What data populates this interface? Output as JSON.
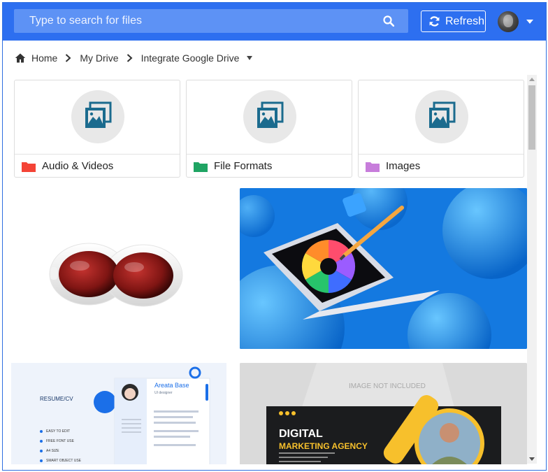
{
  "search": {
    "placeholder": "Type to search for files",
    "icon": "search-icon"
  },
  "toolbar": {
    "refresh_label": "Refresh",
    "refresh_icon": "refresh-icon"
  },
  "user": {
    "avatar_icon": "avatar",
    "menu_icon": "chevron-down-icon"
  },
  "breadcrumb": {
    "items": [
      {
        "label": "Home",
        "icon": "home-icon"
      },
      {
        "label": "My Drive"
      },
      {
        "label": "Integrate Google Drive"
      }
    ]
  },
  "folders": [
    {
      "name": "Audio & Videos",
      "color": "#f44336"
    },
    {
      "name": "File Formats",
      "color": "#1fa463"
    },
    {
      "name": "Images",
      "color": "#c77ddb"
    }
  ],
  "files": {
    "goggles": {
      "description": "white goggles with red lenses"
    },
    "laptop": {
      "description": "laptop with color wheel"
    },
    "resume": {
      "heading": "RESUME/CV",
      "name": "Areata Base",
      "role": "UI designer",
      "features": [
        "EASY TO EDIT",
        "FREE FONT USE",
        "A4 SIZE",
        "SMART OBJECT USE"
      ]
    },
    "marketing": {
      "note": "IMAGE NOT INCLUDED",
      "line1": "DIGITAL",
      "line2": "MARKETING AGENCY"
    }
  },
  "colors": {
    "accent": "#2d6ff0",
    "search_bg": "#5d92f5"
  }
}
